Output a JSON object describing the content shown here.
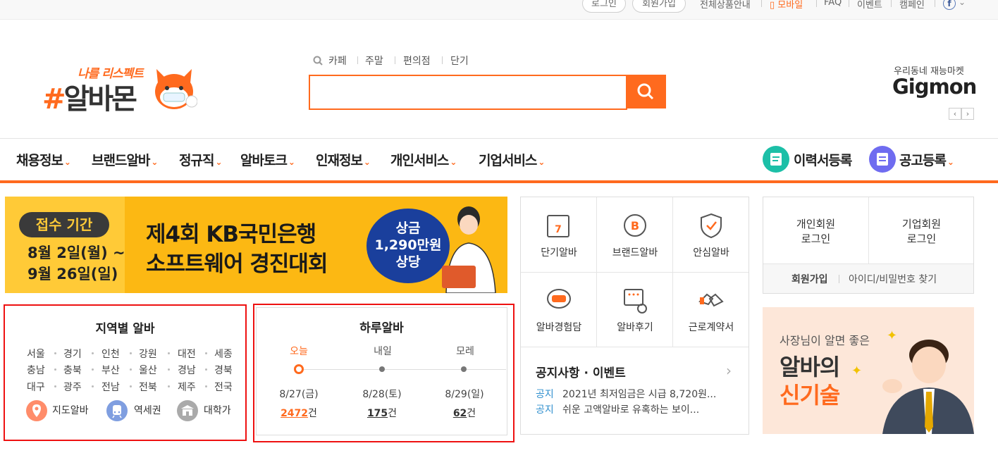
{
  "util": {
    "login": "로그인",
    "signup": "회원가입",
    "products": "전체상품안내",
    "mobile": "모바일",
    "faq": "FAQ",
    "event": "이벤트",
    "campaign": "캠페인"
  },
  "header": {
    "logo_sub": "나를 리스펙트",
    "logo_hash": "#",
    "logo_name": "알바몬",
    "keywords": [
      "카페",
      "주말",
      "편의점",
      "단기"
    ],
    "search_value": "",
    "gigmon_sub": "우리동네 재능마켓",
    "gigmon_name": "Gigmon",
    "prev": "‹",
    "next": "›"
  },
  "nav": {
    "items": [
      "채용정보",
      "브랜드알바",
      "정규직",
      "알바토크",
      "인재정보",
      "개인서비스",
      "기업서비스"
    ],
    "resume": "이력서등록",
    "post": "공고등록"
  },
  "banner": {
    "tag": "접수 기간",
    "date1": "8월 2일(월) ~",
    "date2": "9월 26일(일)",
    "title1": "제4회 KB국민은행",
    "title2": "소프트웨어 경진대회",
    "prize1": "상금",
    "prize2": "1,290만원",
    "prize3": "상당"
  },
  "services": [
    "단기알바",
    "브랜드알바",
    "안심알바",
    "알바경험담",
    "알바후기",
    "근로계약서"
  ],
  "notice": {
    "title": "공지사항 · 이벤트",
    "items": [
      {
        "tag": "공지",
        "text": "2021년 최저임금은 시급 8,720원..."
      },
      {
        "tag": "공지",
        "text": "쉬운 고액알바로 유혹하는 보이..."
      }
    ]
  },
  "login": {
    "personal1": "개인회원",
    "personal2": "로그인",
    "corp1": "기업회원",
    "corp2": "로그인",
    "signup": "회원가입",
    "find": "아이디/비밀번호 찾기"
  },
  "ad": {
    "line1": "사장님이 알면 좋은",
    "line2": "알바의",
    "line3": "신기술"
  },
  "region": {
    "title": "지역별 알바",
    "rows": [
      [
        "서울",
        "경기",
        "인천",
        "강원",
        "대전",
        "세종"
      ],
      [
        "충남",
        "충북",
        "부산",
        "울산",
        "경남",
        "경북"
      ],
      [
        "대구",
        "광주",
        "전남",
        "전북",
        "제주",
        "전국"
      ]
    ],
    "map": "지도알바",
    "station": "역세권",
    "univ": "대학가"
  },
  "daily": {
    "title": "하루알바",
    "days": [
      "오늘",
      "내일",
      "모레"
    ],
    "dates": [
      "8/27(금)",
      "8/28(토)",
      "8/29(일)"
    ],
    "counts": [
      "2472",
      "175",
      "62"
    ],
    "unit": "건"
  },
  "colors": {
    "accent": "#ff6a1e",
    "banner": "#fcb813",
    "highlight": "#e11111"
  }
}
